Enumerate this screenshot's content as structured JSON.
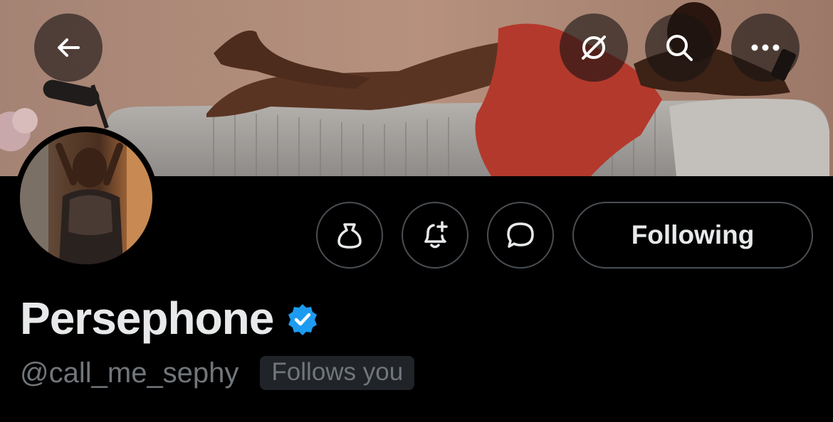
{
  "header": {
    "back_icon": "arrow-left-icon",
    "grok_icon": "grok-icon",
    "search_icon": "search-icon",
    "more_icon": "more-horizontal-icon"
  },
  "banner": {
    "description_colors": {
      "wall": "#b08a78",
      "couch": "#b9b6b1",
      "dress": "#b8382c"
    }
  },
  "actions": {
    "tip_icon": "money-bag-icon",
    "notify_icon": "bell-plus-icon",
    "message_icon": "chat-bubble-icon",
    "following_label": "Following"
  },
  "profile": {
    "display_name": "Persephone",
    "verified_icon": "verified-badge-icon",
    "verified_color": "#1d9bf0",
    "handle": "@call_me_sephy",
    "follows_you": "Follows you"
  }
}
